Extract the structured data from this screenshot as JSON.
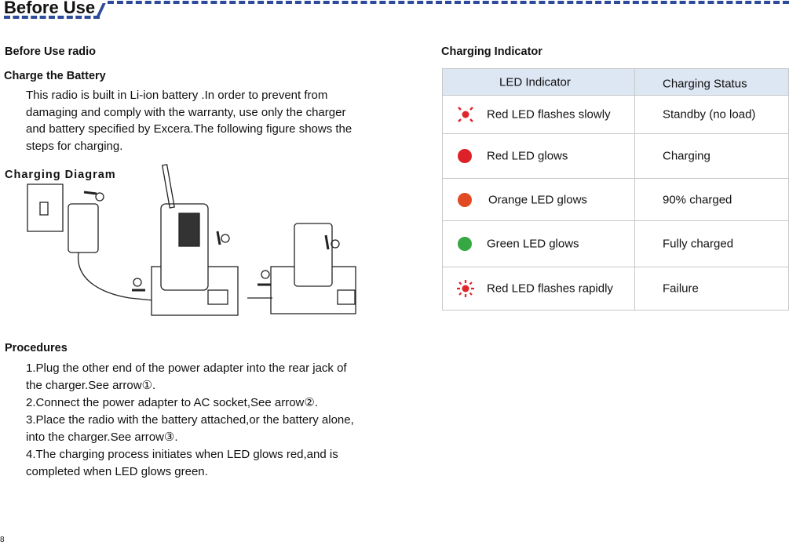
{
  "header": {
    "title": "Before Use"
  },
  "left": {
    "section_title": "Before Use radio",
    "charge_heading": "Charge the Battery",
    "intro_lines": [
      "This radio is built in Li-ion battery .In order to prevent from",
      "damaging and  comply with the warranty, use only the charger",
      "and battery specified by Excera.The following figure shows the",
      "steps for charging."
    ],
    "diagram_title": "Charging Diagram",
    "diagram_markers": [
      "①",
      "②",
      "③"
    ],
    "procedures_heading": "Procedures",
    "procedure_lines": [
      "1.Plug the other end of the power adapter into the rear jack of",
      "the charger.See  arrow①.",
      "2.Connect the power adapter to AC socket,See arrow②.",
      "3.Place the radio with the battery attached,or the battery alone,",
      "into the charger.See arrow③.",
      "4.The charging process initiates when LED glows red,and is",
      "completed when LED glows green."
    ]
  },
  "right": {
    "section_title": "Charging Indicator",
    "table": {
      "headers": [
        "LED Indicator",
        "Charging Status"
      ],
      "rows": [
        {
          "led": "Red LED flashes slowly",
          "status": "Standby (no load)",
          "color": "#e0262b",
          "icon": "flash-slow-icon"
        },
        {
          "led": "Red LED glows",
          "status": "Charging",
          "color": "#dc2128",
          "icon": "solid-dot-icon"
        },
        {
          "led": "Orange LED glows",
          "status": "90% charged",
          "color": "#e24a24",
          "icon": "solid-dot-icon"
        },
        {
          "led": "Green LED glows",
          "status": "Fully charged",
          "color": "#36a843",
          "icon": "solid-dot-icon"
        },
        {
          "led": "Red LED flashes rapidly",
          "status": "Failure",
          "color": "#e0262b",
          "icon": "flash-rapid-icon"
        }
      ]
    }
  },
  "footer": {
    "page_number": "8"
  },
  "colors": {
    "accent_dash": "#2E4A9A",
    "table_header_bg": "#dde6f3"
  }
}
